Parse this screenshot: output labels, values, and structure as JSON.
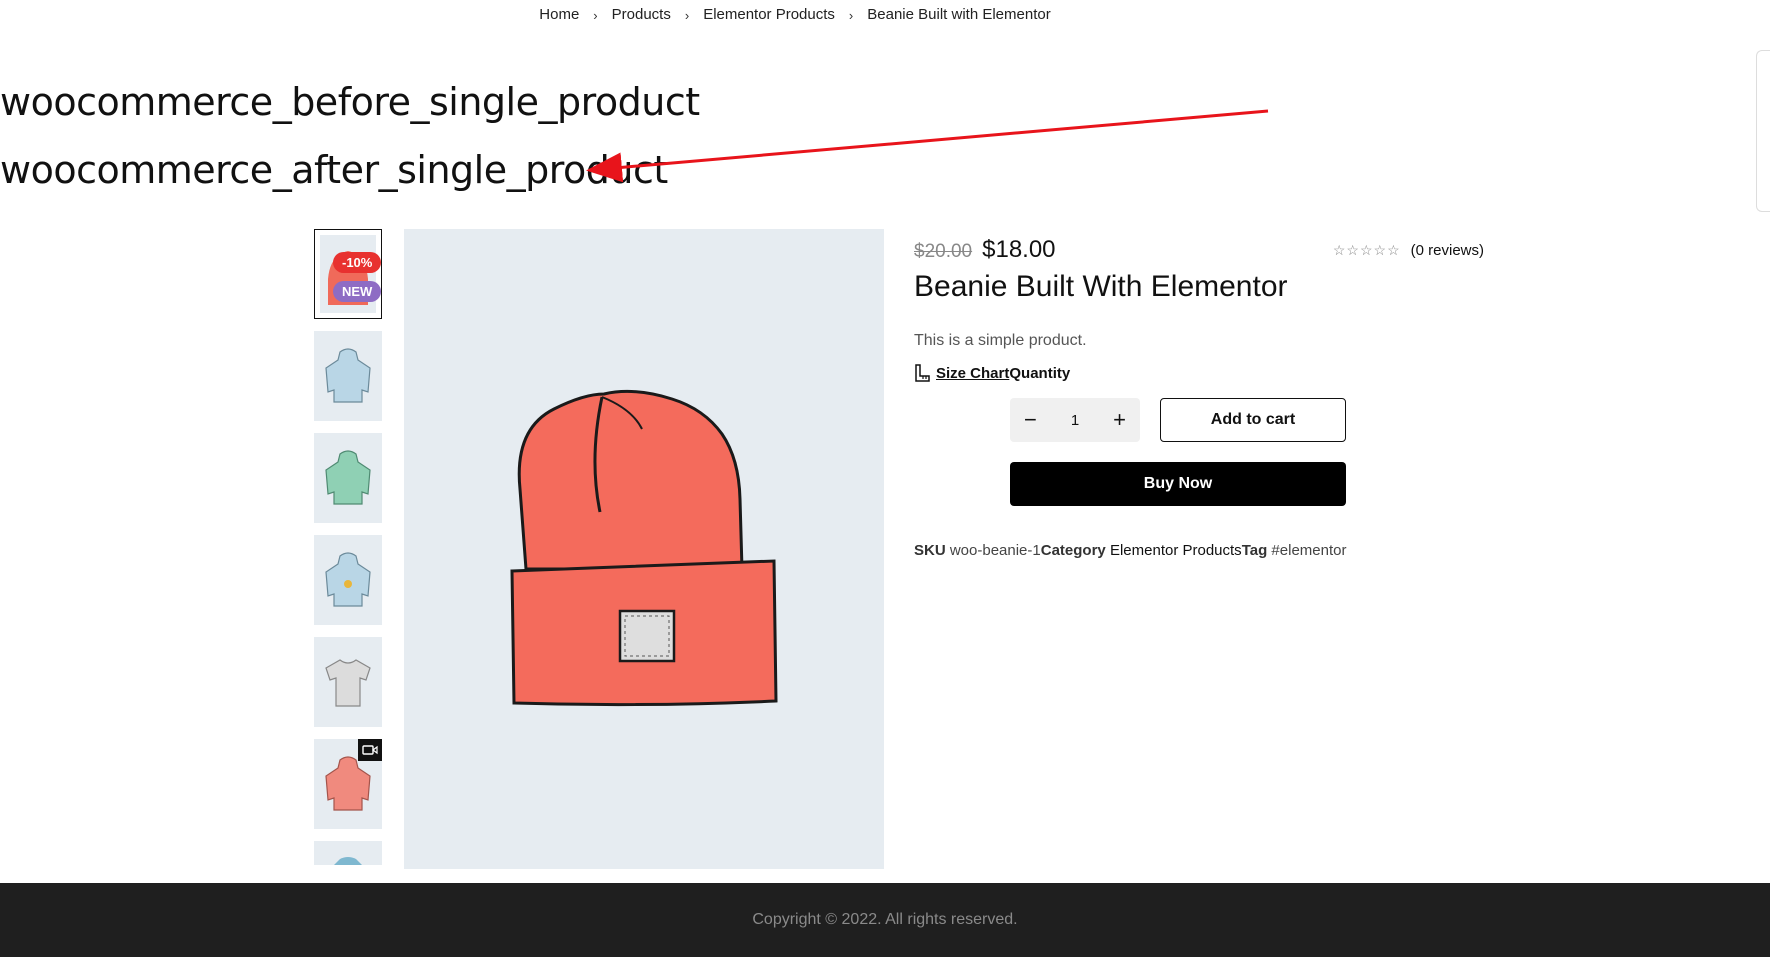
{
  "breadcrumb": [
    "Home",
    "Products",
    "Elementor Products",
    "Beanie Built with Elementor"
  ],
  "hooks": {
    "before": "woocommerce_before_single_product",
    "after": "woocommerce_after_single_product"
  },
  "badges": {
    "sale": "-10%",
    "new": "NEW"
  },
  "product": {
    "price_old": "$20.00",
    "price_new": "$18.00",
    "reviews": "(0 reviews)",
    "rating_stars": 0,
    "title": "Beanie Built With Elementor",
    "description": "This is a simple product.",
    "size_chart": "Size Chart",
    "quantity_label": "Quantity",
    "quantity": "1",
    "add_to_cart": "Add to cart",
    "buy_now": "Buy Now",
    "sku_label": "SKU",
    "sku": "woo-beanie-1",
    "category_label": "Category",
    "category": "Elementor Products",
    "tag_label": "Tag",
    "tag": "#elementor"
  },
  "colors": {
    "sale_badge": "#e8312f",
    "new_badge": "#8e6cc4",
    "annotation_arrow": "#e8141b",
    "footer_bg": "#1f1f1f"
  },
  "footer": {
    "copyright": "Copyright © 2022. All rights reserved."
  }
}
